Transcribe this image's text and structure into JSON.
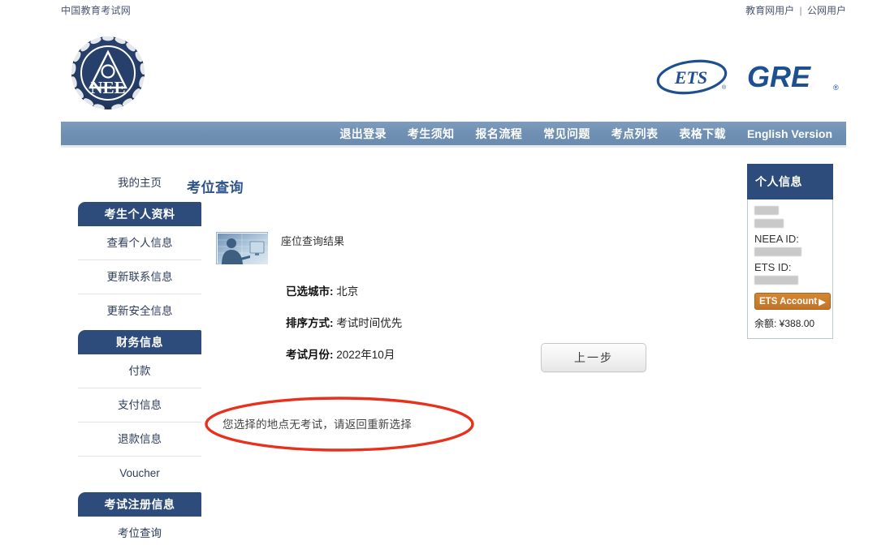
{
  "topbar": {
    "site_name": "中国教育考试网",
    "user_links": [
      "教育网用户",
      "公网用户"
    ],
    "separator": "|"
  },
  "branding": {
    "neea_logo_text": "NEE",
    "neea_logo_name": "neea-logo",
    "ets_logo_text": "ETS",
    "ets_reg": "®",
    "gre_logo_text": "GRE",
    "gre_reg": "®"
  },
  "nav": {
    "items": [
      {
        "label": "退出登录",
        "name": "nav-logout"
      },
      {
        "label": "考生须知",
        "name": "nav-candidate-notice"
      },
      {
        "label": "报名流程",
        "name": "nav-registration-process"
      },
      {
        "label": "常见问题",
        "name": "nav-faq"
      },
      {
        "label": "考点列表",
        "name": "nav-test-center-list"
      },
      {
        "label": "表格下载",
        "name": "nav-form-download"
      },
      {
        "label": "English Version",
        "name": "nav-english-version"
      }
    ]
  },
  "sidebar": {
    "home": "我的主页",
    "groups": [
      {
        "header": "考生个人资料",
        "items": [
          "查看个人信息",
          "更新联系信息",
          "更新安全信息"
        ]
      },
      {
        "header": "财务信息",
        "items": [
          "付款",
          "支付信息",
          "退款信息",
          "Voucher"
        ]
      },
      {
        "header": "考试注册信息",
        "items": [
          "考位查询"
        ]
      }
    ]
  },
  "main": {
    "page_title": "考位查询",
    "result_label": "座位查询结果",
    "thumbnail_name": "person-at-computer-image",
    "details": [
      {
        "key": "已选城市:",
        "value": "北京"
      },
      {
        "key": "排序方式:",
        "value": "考试时间优先"
      },
      {
        "key": "考试月份:",
        "value": "2022年10月"
      }
    ],
    "prev_button": "上一步",
    "warning_text": "您选择的地点无考试，请返回重新选择",
    "annotation_color": "#e8301c"
  },
  "info_panel": {
    "title": "个人信息",
    "neea_id_label": "NEEA ID:",
    "ets_id_label": "ETS ID:",
    "ets_account_button": "ETS Account",
    "ets_account_arrow": "▶",
    "balance": "余额: ¥388.00"
  },
  "colors": {
    "nav_blue": "#6e8fb2",
    "header_navy": "#2d4c7b",
    "title_blue": "#2d558c",
    "accent_orange": "#c4742a",
    "annotation_red": "#e8301c"
  }
}
